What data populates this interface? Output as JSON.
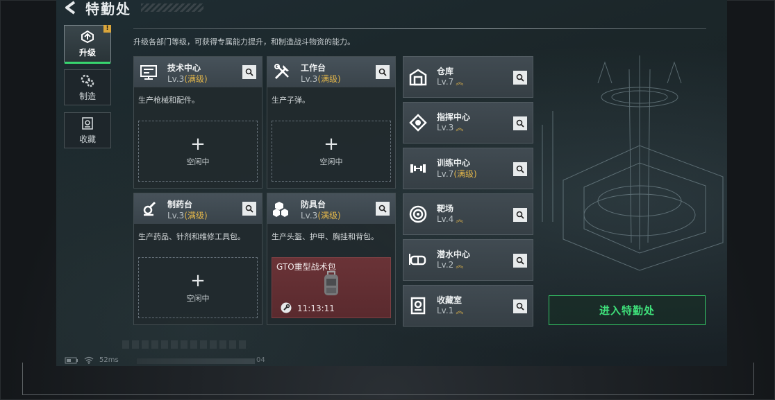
{
  "header": {
    "title": "特勤处"
  },
  "sidenav": [
    {
      "label": "升级",
      "icon": "upgrade-icon",
      "active": true,
      "badge": "!"
    },
    {
      "label": "制造",
      "icon": "gears-icon",
      "active": false
    },
    {
      "label": "收藏",
      "icon": "collection-icon",
      "active": false
    }
  ],
  "description": "升级各部门等级，可获得专属能力提升，和制造战斗物资的能力。",
  "workshops": [
    {
      "name": "技术中心",
      "level": "Lv.3",
      "max": "(满级)",
      "icon": "tech-center-icon",
      "desc": "生产枪械和配件。",
      "slot_plus": "+",
      "slot_status": "空闲中"
    },
    {
      "name": "工作台",
      "level": "Lv.3",
      "max": "(满级)",
      "icon": "workbench-tools-icon",
      "desc": "生产子弹。",
      "slot_plus": "+",
      "slot_status": "空闲中"
    },
    {
      "name": "制药台",
      "level": "Lv.3",
      "max": "(满级)",
      "icon": "pharmacy-icon",
      "desc": "生产药品、针剂和维修工具包。",
      "slot_plus": "+",
      "slot_status": "空闲中"
    },
    {
      "name": "防具台",
      "level": "Lv.3",
      "max": "(满级)",
      "icon": "armor-bench-icon",
      "desc": "生产头盔、护甲、胸挂和背包。",
      "crafting_item": "GTO重型战术包",
      "crafting_timer": "11:13:11"
    }
  ],
  "rooms": [
    {
      "name": "仓库",
      "level": "Lv.7",
      "max": "",
      "upgradeable": true,
      "icon": "warehouse-icon"
    },
    {
      "name": "指挥中心",
      "level": "Lv.3",
      "max": "",
      "upgradeable": true,
      "icon": "command-center-icon"
    },
    {
      "name": "训练中心",
      "level": "Lv.7",
      "max": "(满级)",
      "upgradeable": false,
      "icon": "dumbbell-icon"
    },
    {
      "name": "靶场",
      "level": "Lv.4",
      "max": "",
      "upgradeable": true,
      "icon": "target-icon"
    },
    {
      "name": "潜水中心",
      "level": "Lv.2",
      "max": "",
      "upgradeable": true,
      "icon": "diving-mask-icon"
    },
    {
      "name": "收藏室",
      "level": "Lv.1",
      "max": "",
      "upgradeable": true,
      "icon": "collection-room-icon"
    }
  ],
  "enter_button": "进入特勤处",
  "status": {
    "ping": "52ms",
    "bar_number": "04"
  },
  "colors": {
    "accent_green": "#37d66f",
    "max_level_gold": "#e1b54a",
    "crafting_red": "#6a3337"
  }
}
